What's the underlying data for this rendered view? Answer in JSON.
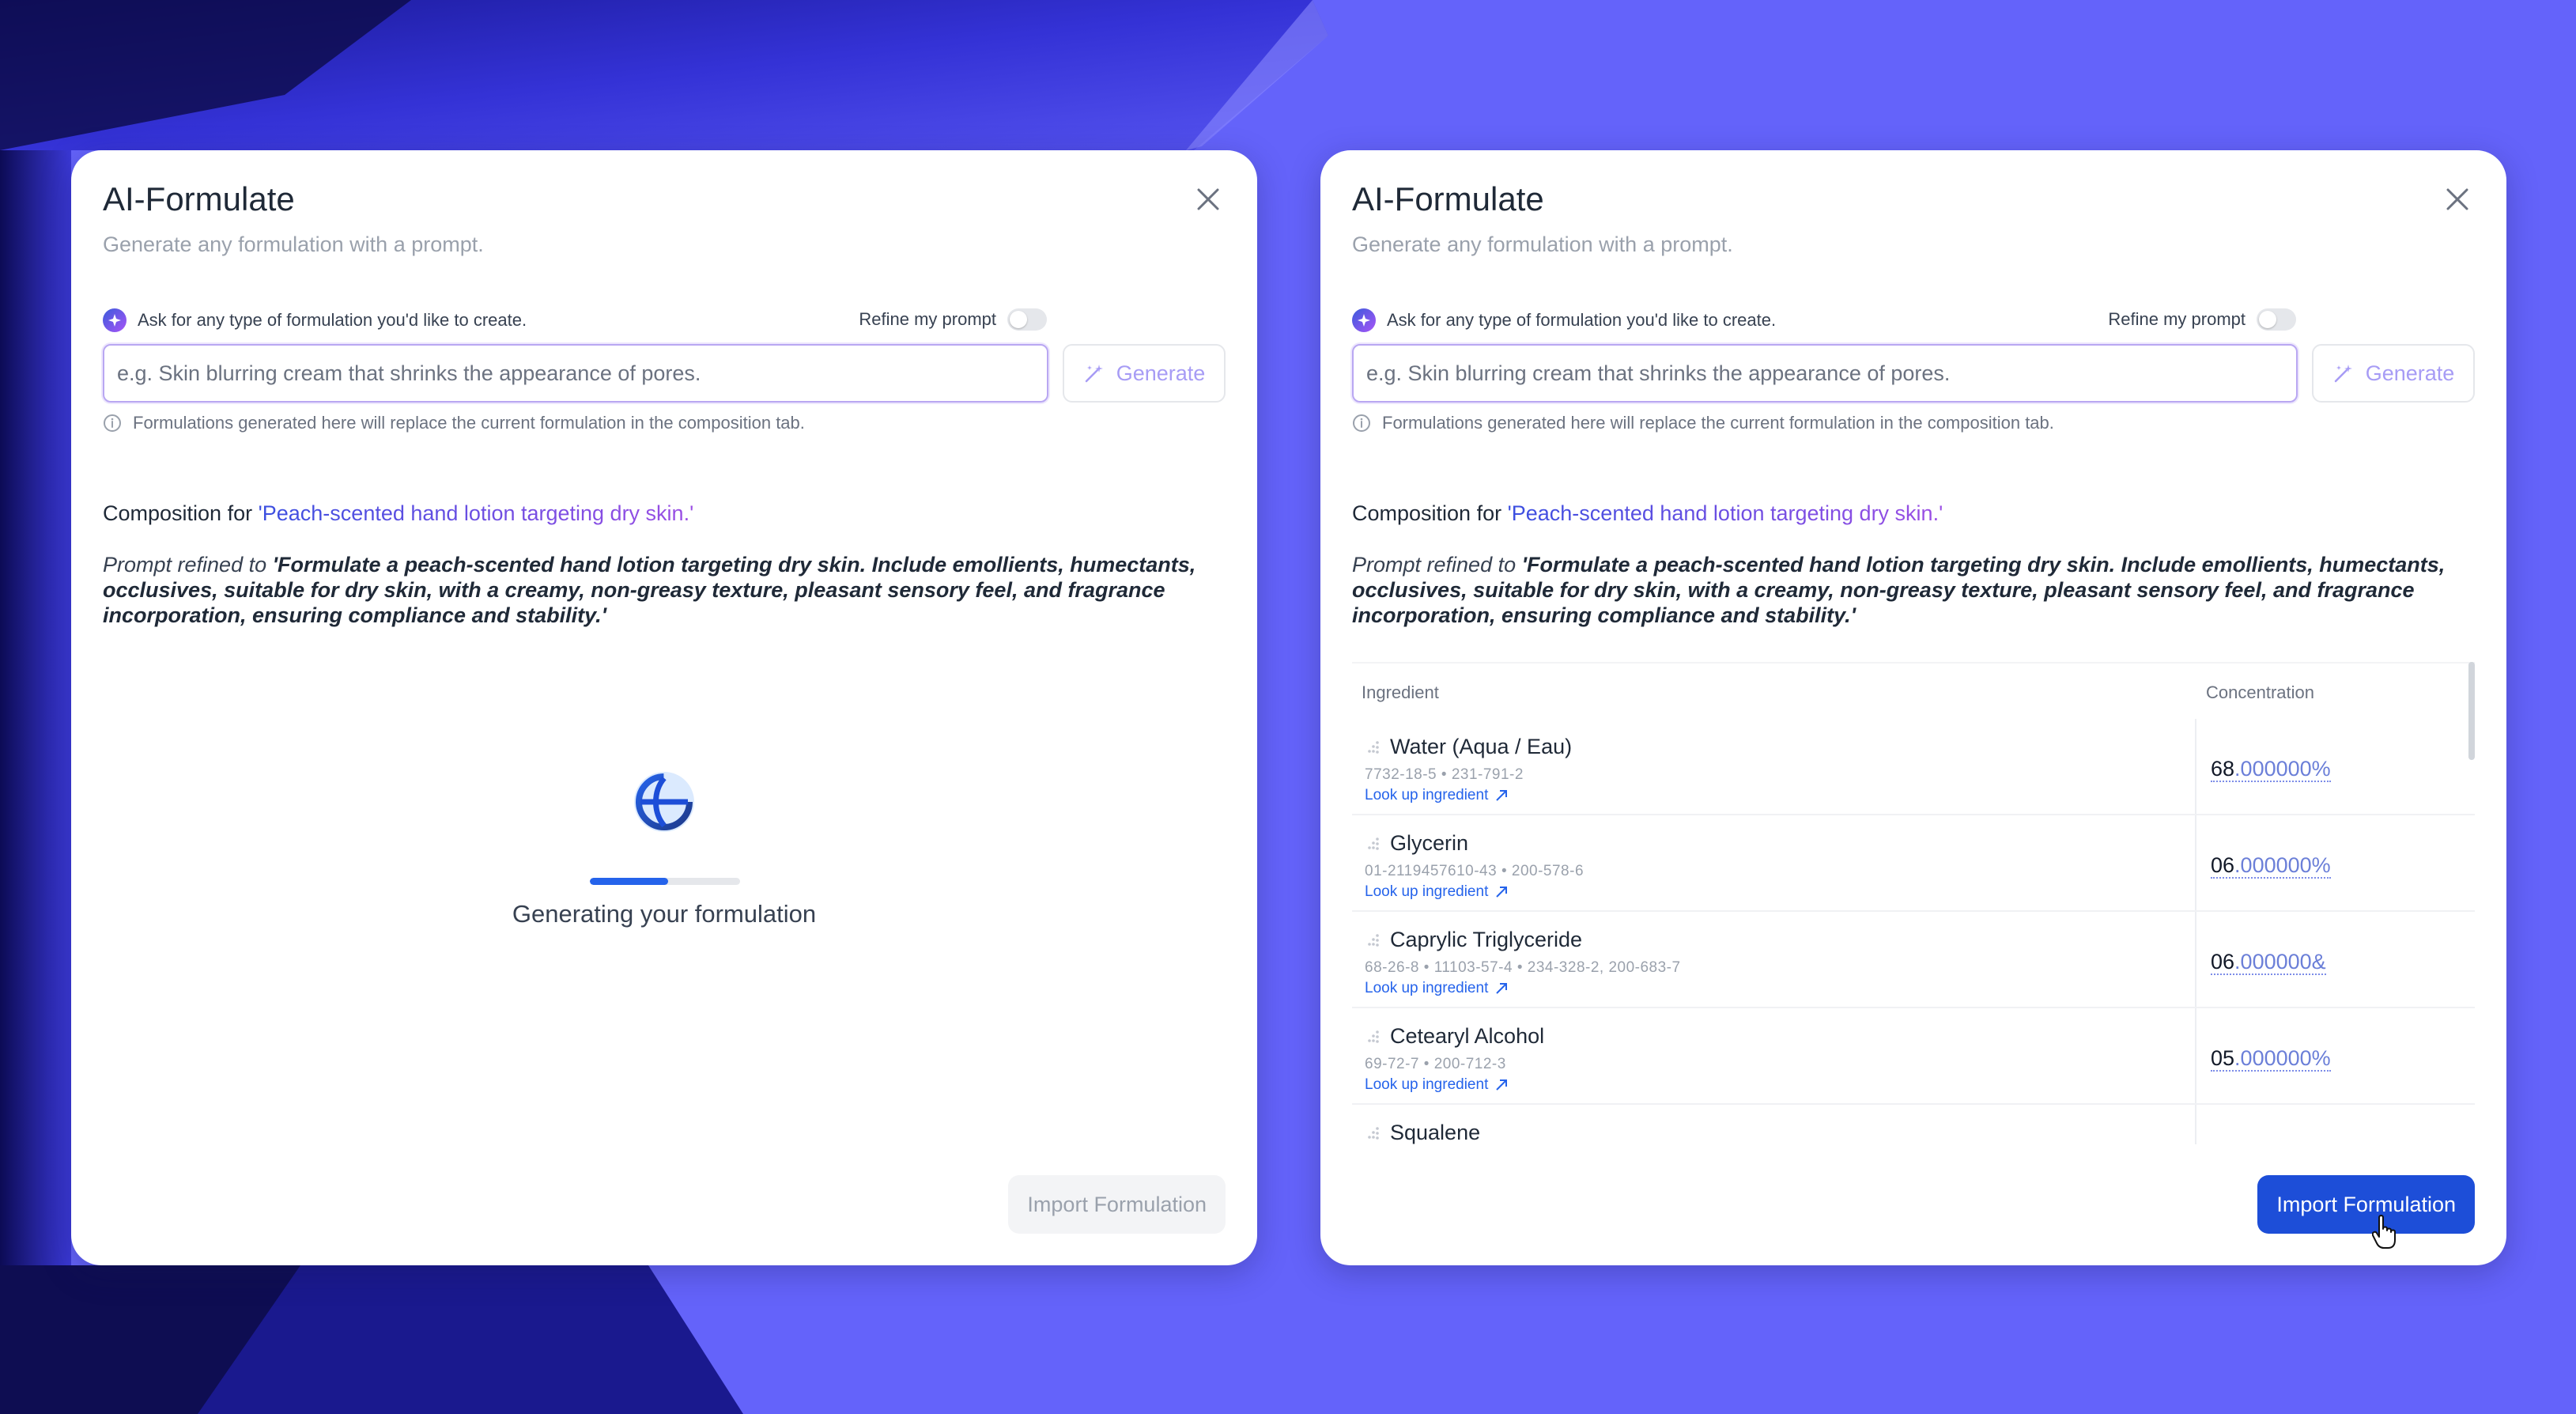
{
  "panels": [
    {
      "id": "loading",
      "title": "AI-Formulate",
      "subtitle": "Generate any formulation with a prompt.",
      "ask_label": "Ask for any type of formulation you'd like to create.",
      "refine_label": "Refine my prompt",
      "refine_on": false,
      "prompt_placeholder": "e.g. Skin blurring cream that shrinks the appearance of pores.",
      "generate_label": "Generate",
      "info_note": "Formulations generated here will replace the current formulation in the composition tab.",
      "composition_prefix": "Composition for ",
      "composition_query": "'Peach-scented hand lotion targeting dry skin.'",
      "refined_prefix": "Prompt refined to ",
      "refined_text": "'Formulate a peach-scented hand lotion targeting dry skin. Include emollients, humectants, occlusives, suitable for dry skin, with a creamy, non-greasy texture, pleasant sensory feel, and fragrance incorporation, ensuring compliance and stability.'",
      "loading_text": "Generating your formulation",
      "progress": 0.52,
      "import_label": "Import Formulation",
      "import_enabled": false
    },
    {
      "id": "result",
      "title": "AI-Formulate",
      "subtitle": "Generate any formulation with a prompt.",
      "ask_label": "Ask for any type of formulation you'd like to create.",
      "refine_label": "Refine my prompt",
      "refine_on": false,
      "prompt_placeholder": "e.g. Skin blurring cream that shrinks the appearance of pores.",
      "generate_label": "Generate",
      "info_note": "Formulations generated here will replace the current formulation in the composition tab.",
      "composition_prefix": "Composition for ",
      "composition_query": "'Peach-scented hand lotion targeting dry skin.'",
      "refined_prefix": "Prompt refined to ",
      "refined_text": "'Formulate a peach-scented hand lotion targeting dry skin. Include emollients, humectants, occlusives, suitable for dry skin, with a creamy, non-greasy texture, pleasant sensory feel, and fragrance incorporation, ensuring compliance and stability.'",
      "table": {
        "col_ingredient": "Ingredient",
        "col_concentration": "Concentration",
        "lookup_label": "Look up ingredient",
        "rows": [
          {
            "name": "Water (Aqua / Eau)",
            "ids": "7732-18-5 • 231-791-2",
            "conc_int": "68",
            "conc_dec": ".000000%"
          },
          {
            "name": "Glycerin",
            "ids": "01-2119457610-43 • 200-578-6",
            "conc_int": "06",
            "conc_dec": ".000000%"
          },
          {
            "name": "Caprylic Triglyceride",
            "ids": "68-26-8 • 11103-57-4 • 234-328-2, 200-683-7",
            "conc_int": "06",
            "conc_dec": ".000000&"
          },
          {
            "name": "Cetearyl Alcohol",
            "ids": "69-72-7 • 200-712-3",
            "conc_int": "05",
            "conc_dec": ".000000%"
          },
          {
            "name": "Squalene",
            "ids": "",
            "conc_int": "",
            "conc_dec": ""
          }
        ]
      },
      "import_label": "Import Formulation",
      "import_enabled": true
    }
  ],
  "colors": {
    "background": "#6463fa",
    "primary": "#1d4ed8",
    "link": "#2563eb",
    "accent_purple": "#9b4ee4"
  }
}
